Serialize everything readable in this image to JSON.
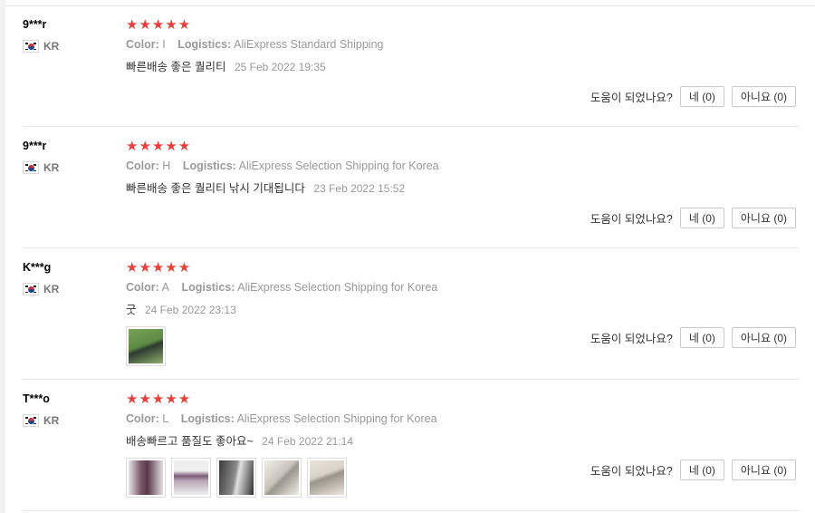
{
  "labels": {
    "color_key": "Color:",
    "logistics_key": "Logistics:",
    "helpful_question": "도움이 되었나요?"
  },
  "reviews": [
    {
      "user": "9***r",
      "country": "KR",
      "rating": 5,
      "stars": "★★★★★",
      "color": "I",
      "logistics": "AliExpress Standard Shipping",
      "comment": "빠른배송 좋은 퀄리티",
      "date": "25 Feb 2022 19:35",
      "yes_label": "네 (0)",
      "no_label": "아니요 (0)",
      "photos": []
    },
    {
      "user": "9***r",
      "country": "KR",
      "rating": 5,
      "stars": "★★★★★",
      "color": "H",
      "logistics": "AliExpress Selection Shipping for Korea",
      "comment": "빠른배송 좋은 퀄리티 낚시 기대됩니다",
      "date": "23 Feb 2022 15:52",
      "yes_label": "네 (0)",
      "no_label": "아니요 (0)",
      "photos": []
    },
    {
      "user": "K***g",
      "country": "KR",
      "rating": 5,
      "stars": "★★★★★",
      "color": "A",
      "logistics": "AliExpress Selection Shipping for Korea",
      "comment": "굿",
      "date": "24 Feb 2022 23:13",
      "yes_label": "네 (0)",
      "no_label": "아니요 (0)",
      "photos": [
        {
          "name": "review-photo-1",
          "color": "#6a9a4a"
        }
      ]
    },
    {
      "user": "T***o",
      "country": "KR",
      "rating": 5,
      "stars": "★★★★★",
      "color": "L",
      "logistics": "AliExpress Selection Shipping for Korea",
      "comment": "배송빠르고 품질도 좋아요~",
      "date": "24 Feb 2022 21:14",
      "yes_label": "네 (0)",
      "no_label": "아니요 (0)",
      "photos": [
        {
          "name": "review-photo-1",
          "color": "#7a5a6a"
        },
        {
          "name": "review-photo-2",
          "color": "#b9a9b6"
        },
        {
          "name": "review-photo-3",
          "color": "#8a8a8a"
        },
        {
          "name": "review-photo-4",
          "color": "#c9c4bc"
        },
        {
          "name": "review-photo-5",
          "color": "#d8d2c8"
        }
      ]
    }
  ]
}
